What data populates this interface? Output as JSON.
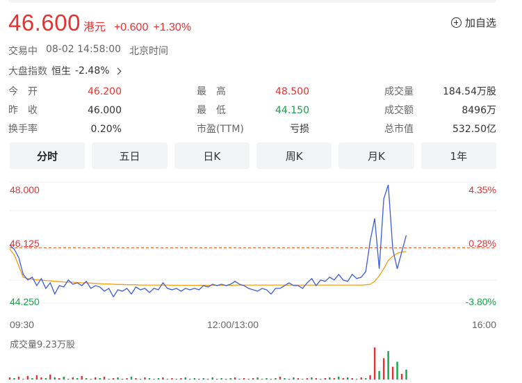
{
  "quote": {
    "price": "46.600",
    "currency": "港元",
    "change": "+0.600",
    "change_pct": "+1.30%"
  },
  "watchlist": {
    "label": "加自选"
  },
  "status": {
    "state": "交易中",
    "datetime": "08-02 14:58:00",
    "timezone": "北京时间"
  },
  "index": {
    "label": "大盘指数",
    "name": "恒生",
    "value": "-2.48%"
  },
  "stats": [
    {
      "key": "今　开",
      "value": "46.200",
      "color": "red"
    },
    {
      "key": "最　高",
      "value": "48.500",
      "color": "red"
    },
    {
      "key": "成交量",
      "value": "184.54万股",
      "color": ""
    },
    {
      "key": "昨　收",
      "value": "46.000",
      "color": ""
    },
    {
      "key": "最　低",
      "value": "44.150",
      "color": "green"
    },
    {
      "key": "成交额",
      "value": "8496万",
      "color": ""
    },
    {
      "key": "换手率",
      "value": "0.20%",
      "color": ""
    },
    {
      "key": "市盈(TTM)",
      "value": "亏损",
      "color": ""
    },
    {
      "key": "总市值",
      "value": "532.50亿",
      "color": ""
    }
  ],
  "tabs": [
    {
      "label": "分时",
      "active": true
    },
    {
      "label": "五日",
      "active": false
    },
    {
      "label": "日K",
      "active": false
    },
    {
      "label": "周K",
      "active": false
    },
    {
      "label": "月K",
      "active": false
    },
    {
      "label": "1年",
      "active": false
    }
  ],
  "chart_data": {
    "type": "line",
    "ylim": [
      44.25,
      48.0
    ],
    "y_tick_labels": [
      "48.000",
      "46.125",
      "44.250"
    ],
    "pct_tick_labels": [
      "4.35%",
      "0.28%",
      "-3.80%"
    ],
    "prev_close": 46.0,
    "x_tick_labels": [
      "09:30",
      "12:00/13:00",
      "16:00"
    ],
    "series": [
      {
        "values": [
          46.15,
          46.0,
          45.7,
          45.1,
          44.9,
          45.0,
          44.7,
          44.95,
          44.6,
          44.8,
          44.4,
          44.7,
          44.65,
          44.9,
          44.75,
          44.8,
          44.7,
          44.85,
          44.6,
          44.7,
          44.65,
          44.5,
          44.6,
          44.3,
          44.55,
          44.5,
          44.6,
          44.4,
          44.65,
          44.55,
          44.6,
          44.45,
          44.6,
          44.55,
          44.8,
          44.6,
          44.55,
          44.6,
          44.5,
          44.6,
          44.55,
          44.6,
          44.55,
          44.7,
          44.65,
          44.75,
          44.7,
          44.75,
          44.7,
          44.75,
          44.85,
          44.75,
          44.7,
          44.6,
          44.55,
          44.5,
          44.6,
          44.55,
          44.4,
          44.6,
          44.6,
          44.7,
          44.8,
          44.7,
          44.7,
          44.6,
          44.8,
          44.95,
          44.7,
          44.9,
          44.85,
          45.0,
          44.9,
          45.1,
          44.9,
          44.85,
          45.1,
          44.95,
          45.0,
          45.2,
          46.3,
          47.1,
          45.3,
          47.8,
          48.5,
          46.0,
          45.3,
          45.9,
          46.5
        ],
        "avg": [
          46.0,
          45.8,
          45.4,
          45.0,
          44.95,
          44.93,
          44.9,
          44.9,
          44.88,
          44.87,
          44.85,
          44.84,
          44.83,
          44.82,
          44.82,
          44.81,
          44.8,
          44.8,
          44.79,
          44.78,
          44.77,
          44.76,
          44.76,
          44.75,
          44.74,
          44.74,
          44.73,
          44.73,
          44.73,
          44.72,
          44.72,
          44.72,
          44.72,
          44.72,
          44.72,
          44.72,
          44.71,
          44.71,
          44.71,
          44.71,
          44.71,
          44.71,
          44.71,
          44.71,
          44.71,
          44.71,
          44.71,
          44.71,
          44.71,
          44.71,
          44.72,
          44.72,
          44.72,
          44.72,
          44.72,
          44.72,
          44.72,
          44.72,
          44.72,
          44.72,
          44.72,
          44.72,
          44.72,
          44.72,
          44.72,
          44.72,
          44.72,
          44.72,
          44.72,
          44.72,
          44.72,
          44.72,
          44.72,
          44.72,
          44.72,
          44.72,
          44.72,
          44.72,
          44.72,
          44.73,
          44.75,
          44.85,
          45.05,
          45.3,
          45.6,
          45.75,
          45.85,
          45.9,
          45.92
        ]
      }
    ],
    "volume": {
      "label": "成交量9.23万股",
      "bars": [
        3,
        2,
        4,
        1,
        5,
        2,
        6,
        3,
        2,
        7,
        3,
        2,
        4,
        1,
        3,
        2,
        5,
        2,
        1,
        3,
        2,
        4,
        1,
        2,
        3,
        1,
        2,
        4,
        2,
        1,
        3,
        2,
        1,
        2,
        3,
        1,
        2,
        1,
        2,
        3,
        1,
        2,
        1,
        2,
        1,
        3,
        1,
        2,
        1,
        2,
        3,
        1,
        2,
        1,
        2,
        3,
        1,
        2,
        1,
        2,
        4,
        2,
        1,
        3,
        2,
        1,
        2,
        3,
        2,
        1,
        2,
        3,
        2,
        4,
        2,
        3,
        2,
        1,
        3,
        2,
        6,
        45,
        12,
        30,
        40,
        18,
        25,
        8,
        14
      ],
      "up": [
        1,
        0,
        1,
        0,
        1,
        0,
        1,
        1,
        0,
        1,
        0,
        1,
        0,
        1,
        1,
        0,
        1,
        0,
        0,
        1,
        0,
        1,
        0,
        1,
        0,
        1,
        1,
        0,
        1,
        0,
        1,
        0,
        1,
        0,
        1,
        0,
        1,
        0,
        1,
        0,
        1,
        0,
        1,
        0,
        1,
        0,
        1,
        0,
        1,
        0,
        1,
        0,
        1,
        0,
        1,
        0,
        1,
        0,
        1,
        0,
        1,
        0,
        1,
        0,
        1,
        0,
        1,
        0,
        1,
        0,
        1,
        0,
        1,
        0,
        1,
        0,
        1,
        0,
        1,
        0,
        1,
        1,
        0,
        1,
        0,
        1,
        0,
        1,
        0
      ]
    },
    "colors": {
      "price_line": "#3b5bdb",
      "avg_line": "#f59e0b",
      "prev_close_line": "#f06a3a",
      "up": "#e83232",
      "down": "#16a34a",
      "grid": "#ececec"
    }
  }
}
